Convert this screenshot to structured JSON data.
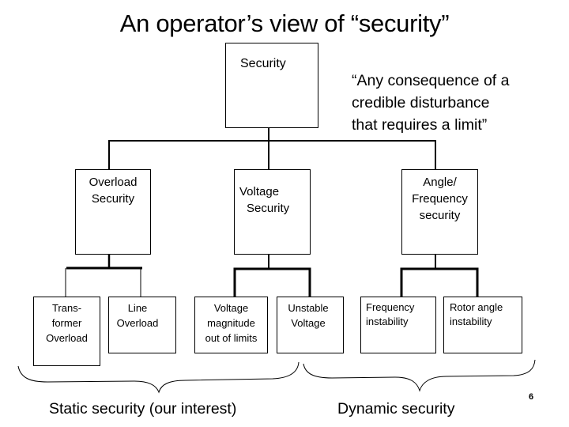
{
  "title": "An operator’s view of “security”",
  "definition_quote": {
    "lines": [
      "“Any consequence of a",
      "credible disturbance",
      "that requires a limit”"
    ]
  },
  "tree": {
    "root": {
      "label": "Security"
    },
    "categories": [
      {
        "label_lines": [
          "Overload",
          "Security"
        ],
        "children": [
          {
            "label_lines": [
              "Trans-",
              "former",
              "Overload"
            ]
          },
          {
            "label_lines": [
              "Line",
              "Overload"
            ]
          }
        ]
      },
      {
        "label_lines": [
          "Voltage",
          "Security"
        ],
        "children": [
          {
            "label_lines": [
              "Voltage",
              "magnitude",
              "out of limits"
            ]
          },
          {
            "label_lines": [
              "Unstable",
              "Voltage"
            ]
          }
        ]
      },
      {
        "label_lines": [
          "Angle/",
          "Frequency",
          "security"
        ],
        "children": [
          {
            "label_lines": [
              "Frequency",
              "instability"
            ]
          },
          {
            "label_lines": [
              "Rotor angle",
              "instability"
            ]
          }
        ]
      }
    ]
  },
  "groups": {
    "static_label": "Static security (our interest)",
    "dynamic_label": "Dynamic security"
  },
  "page_number": "6"
}
